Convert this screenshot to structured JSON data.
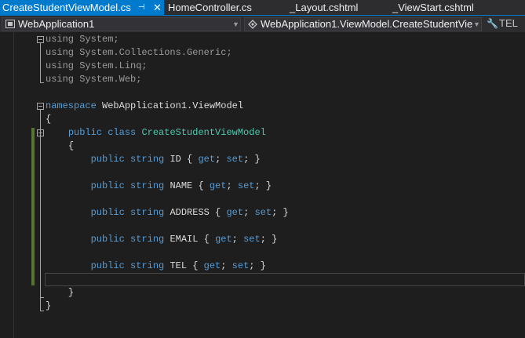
{
  "tabs": [
    {
      "label": "CreateStudentViewModel.cs",
      "active": true,
      "pinned": true
    },
    {
      "label": "HomeController.cs",
      "active": false
    },
    {
      "label": "_Layout.cshtml",
      "active": false
    },
    {
      "label": "_ViewStart.cshtml",
      "active": false
    }
  ],
  "tab_icons": {
    "pin": "⊣",
    "close": "✕"
  },
  "navbar": {
    "project": "WebApplication1",
    "type": "WebApplication1.ViewModel.CreateStudentVie",
    "member": "TEL"
  },
  "colors": {
    "accent": "#007acc",
    "keyword": "#569cd6",
    "type": "#4ec9b0",
    "text": "#dcdcdc",
    "changebar": "#577430"
  },
  "code": {
    "using1_kw": "using",
    "using1_ns": " System;",
    "using2_kw": "using",
    "using2_ns": " System.Collections.Generic;",
    "using3_kw": "using",
    "using3_ns": " System.Linq;",
    "using4_kw": "using",
    "using4_ns": " System.Web;",
    "ns_kw": "namespace",
    "ns_name": " WebApplication1.ViewModel",
    "brace_open": "{",
    "class_mods": "public class ",
    "class_name": "CreateStudentViewModel",
    "class_brace_open": "{",
    "props": [
      {
        "mods": "public string ",
        "name": "ID",
        "open": " { ",
        "get": "get",
        "semi1": "; ",
        "set": "set",
        "close": "; }"
      },
      {
        "mods": "public string ",
        "name": "NAME",
        "open": " { ",
        "get": "get",
        "semi1": "; ",
        "set": "set",
        "close": "; }"
      },
      {
        "mods": "public string ",
        "name": "ADDRESS",
        "open": " { ",
        "get": "get",
        "semi1": "; ",
        "set": "set",
        "close": "; }"
      },
      {
        "mods": "public string ",
        "name": "EMAIL",
        "open": " { ",
        "get": "get",
        "semi1": "; ",
        "set": "set",
        "close": "; }"
      },
      {
        "mods": "public string ",
        "name": "TEL",
        "open": " { ",
        "get": "get",
        "semi1": "; ",
        "set": "set",
        "close": "; }"
      }
    ],
    "class_brace_close": "}",
    "brace_close": "}"
  }
}
